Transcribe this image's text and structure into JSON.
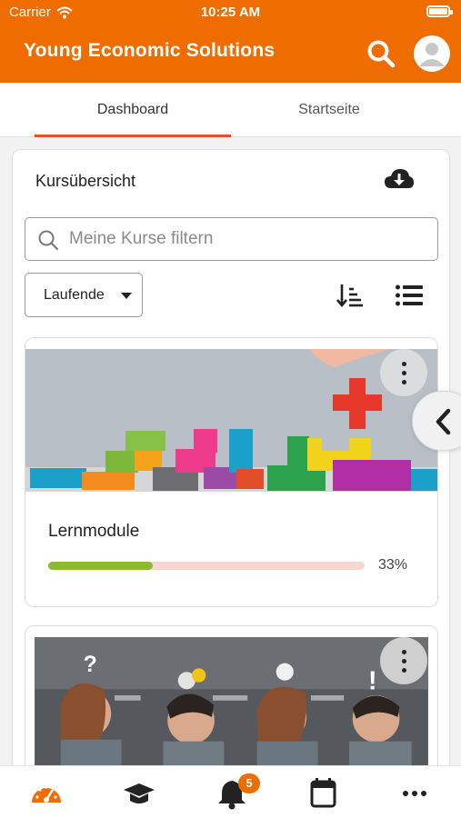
{
  "status_bar": {
    "carrier": "Carrier",
    "time": "10:25 AM"
  },
  "header": {
    "title": "Young Economic Solutions"
  },
  "tabs": [
    {
      "label": "Dashboard",
      "active": true
    },
    {
      "label": "Startseite",
      "active": false
    }
  ],
  "course_overview": {
    "title": "Kursübersicht",
    "filter": {
      "placeholder": "Meine Kurse filtern",
      "value": ""
    },
    "status_select": {
      "value": "Laufende"
    },
    "courses": [
      {
        "name": "Lernmodule",
        "progress_text": "33%",
        "progress": 0.33
      },
      {
        "name": "",
        "progress_text": "",
        "progress": null
      }
    ]
  },
  "bottom_nav": {
    "notification_count": "5"
  },
  "colors": {
    "brand": "#ef6c00",
    "tab_underline": "#e0502a",
    "progress_fill": "#8cbb2e",
    "progress_track": "#f5d7d0"
  },
  "icons": [
    "wifi-icon",
    "battery-icon",
    "search-icon",
    "avatar-icon",
    "cloud-download-icon",
    "filter-search-icon",
    "caret-down-icon",
    "sort-icon",
    "list-view-icon",
    "more-vertical-icon",
    "chevron-left-icon",
    "dashboard-gauge-icon",
    "graduation-cap-icon",
    "bell-icon",
    "calendar-icon",
    "more-horizontal-icon"
  ]
}
